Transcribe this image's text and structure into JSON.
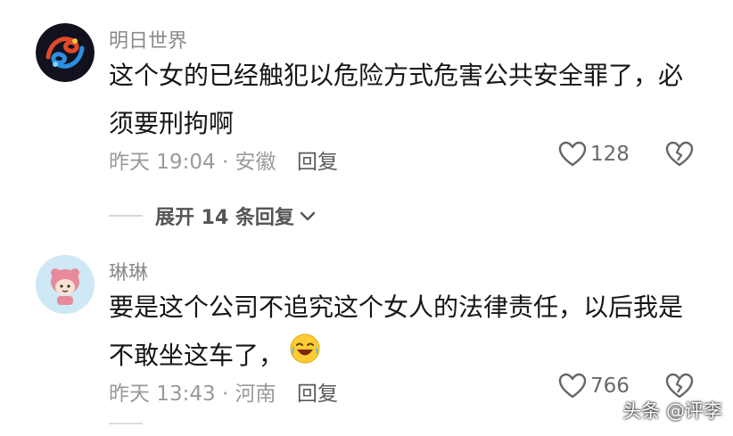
{
  "comments": [
    {
      "username": "明日世界",
      "text": "这个女的已经触犯以危险方式危害公共安全罪了，必须要刑拘啊",
      "meta": "昨天 19:04 · 安徽",
      "reply_label": "回复",
      "likes": "128",
      "expand_label": "展开 14 条回复"
    },
    {
      "username": "琳琳",
      "text": "要是这个公司不追究这个女人的法律责任，以后我是不敢坐这车了，",
      "meta": "昨天 13:43 · 河南",
      "reply_label": "回复",
      "likes": "766"
    }
  ],
  "watermark": "头条 @评李",
  "icons": {
    "like": "heart-outline-icon",
    "dislike": "broken-heart-icon",
    "expand": "chevron-down-icon",
    "emoji": "laugh-cry-emoji-icon"
  },
  "colors": {
    "username": "#8a8a8a",
    "meta": "#9a9a9a",
    "text": "#161616"
  }
}
